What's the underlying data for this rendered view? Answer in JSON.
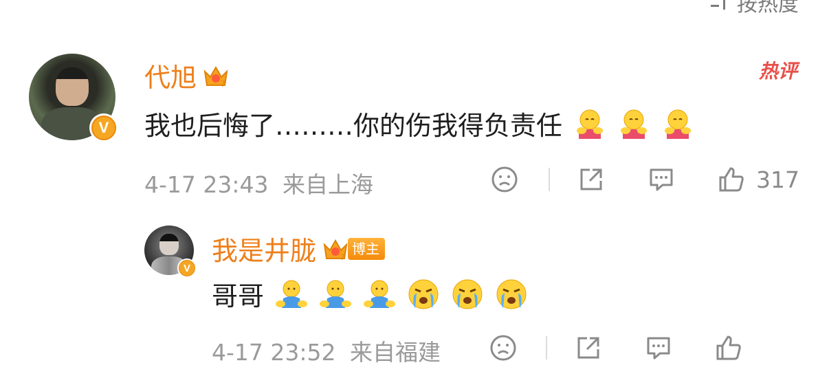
{
  "header": {
    "sort_label": "按热度"
  },
  "comment": {
    "username": "代旭",
    "hot_label": "热评",
    "text": "我也后悔了………你的伤我得负责任",
    "emojis": [
      "hug-emoji",
      "hug-emoji",
      "hug-emoji"
    ],
    "date": "4-17 23:43",
    "location": "来自上海",
    "likes": "317"
  },
  "reply": {
    "username": "我是井胧",
    "badge_label": "博主",
    "text": "哥哥",
    "emojis": [
      "shy-emoji",
      "shy-emoji",
      "shy-emoji",
      "cry-emoji",
      "cry-emoji",
      "cry-emoji"
    ],
    "date": "4-17 23:52",
    "location": "来自福建"
  },
  "colors": {
    "username": "#ee7f1a",
    "hot": "#e8504a",
    "meta": "#9a9a9a"
  }
}
